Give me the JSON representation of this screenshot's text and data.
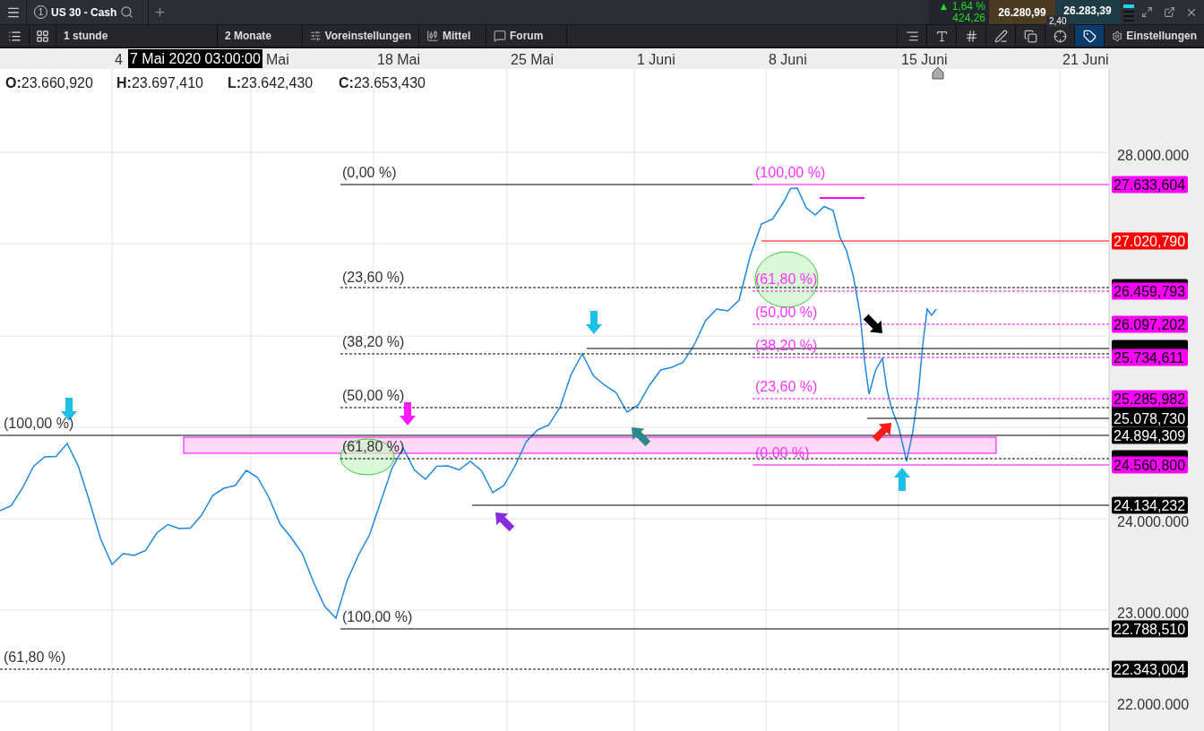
{
  "tab": {
    "number": "1",
    "title": "US 30 - Cash"
  },
  "quote": {
    "change_pct": "▲ 1,64 %",
    "change": "424,26",
    "bid": "26.280,99",
    "ask": "26.283,39",
    "spread": "2,40"
  },
  "toolbar": [
    {
      "kind": "interval",
      "label": "1 stunde"
    },
    {
      "kind": "range",
      "label": "2 Monate"
    },
    {
      "kind": "presets",
      "label": "Voreinstellungen"
    },
    {
      "kind": "style",
      "label": "Mittel"
    },
    {
      "kind": "forum",
      "label": "Forum"
    }
  ],
  "tools": [
    {
      "kind": "scale",
      "selected": false
    },
    {
      "kind": "text",
      "selected": false
    },
    {
      "kind": "grid",
      "selected": false
    },
    {
      "kind": "draw",
      "selected": false
    },
    {
      "kind": "layers",
      "selected": false
    },
    {
      "kind": "crosshair",
      "selected": false
    },
    {
      "kind": "label",
      "selected": true
    }
  ],
  "settings": "Einstellungen",
  "crosshair_time": "7 Mai 2020 03:00:00",
  "date_labels": [
    "4",
    "Mai",
    "18 Mai",
    "25 Mai",
    "1 Juni",
    "8 Juni",
    "15 Juni",
    "21 Juni"
  ],
  "ohlc": [
    {
      "key": "O:",
      "value": "23.660,920"
    },
    {
      "key": "H:",
      "value": "23.697,410"
    },
    {
      "key": "L:",
      "value": "23.642,430"
    },
    {
      "key": "C:",
      "value": "23.653,430"
    }
  ],
  "price_labels": [
    "28.000.000",
    "24.000.000",
    "23.000.000",
    "22.000.000"
  ],
  "fib_labels": [
    {
      "text": "(0,00 %)",
      "color": "#333333"
    },
    {
      "text": "(100,00 %)",
      "color": "#ff33ff"
    },
    {
      "text": "(23,60 %)",
      "color": "#333333"
    },
    {
      "text": "(61,80 %)",
      "color": "#ff33ff"
    },
    {
      "text": "(50,00 %)",
      "color": "#ff33ff"
    },
    {
      "text": "(38,20 %)",
      "color": "#333333"
    },
    {
      "text": "(38,20 %)",
      "color": "#ff33ff"
    },
    {
      "text": "(23,60 %)",
      "color": "#ff33ff"
    },
    {
      "text": "(50,00 %)",
      "color": "#333333"
    },
    {
      "text": "(100,00 %)",
      "color": "#333333"
    },
    {
      "text": "(61,80 %)",
      "color": "#333333"
    },
    {
      "text": "(0,00 %)",
      "color": "#ff33ff"
    },
    {
      "text": "(100,00 %)",
      "color": "#333333"
    },
    {
      "text": "(61,80 %)",
      "color": "#333333"
    }
  ],
  "price_tags": [
    {
      "text": "27.633,604",
      "color": "#ff00ff"
    },
    {
      "text": "27.020,790",
      "color": "#ff0000"
    },
    {
      "text": "26.459,793",
      "color": "#ff00ff"
    },
    {
      "text": "26.097,202",
      "color": "#ff00ff"
    },
    {
      "text": "25.734,611",
      "color": "#ff00ff"
    },
    {
      "text": "25.285,982",
      "color": "#ff00ff"
    },
    {
      "text": "25.078,730",
      "color": "#000000"
    },
    {
      "text": "24.894,309",
      "color": "#000000"
    },
    {
      "text": "24.560,800",
      "color": "#ff00ff"
    },
    {
      "text": "24.134,232",
      "color": "#000000"
    },
    {
      "text": "22.788,510",
      "color": "#000000"
    },
    {
      "text": "22.343,004",
      "color": "#000000"
    }
  ]
}
